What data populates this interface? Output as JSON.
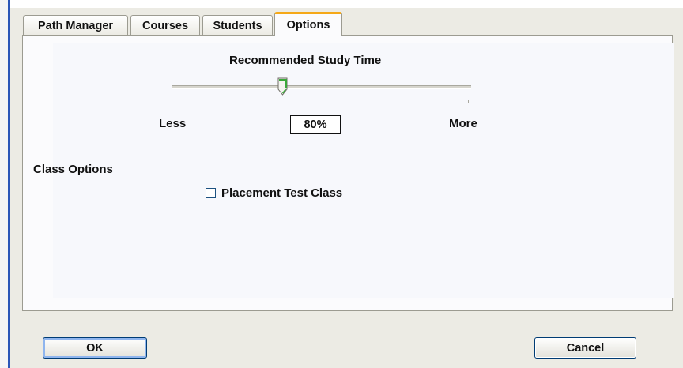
{
  "tabs": [
    {
      "label": "Path Manager"
    },
    {
      "label": "Courses"
    },
    {
      "label": "Students"
    },
    {
      "label": "Options",
      "active": true
    }
  ],
  "study_time": {
    "title": "Recommended Study Time",
    "min_label": "Less",
    "max_label": "More",
    "value_text": "80%",
    "slider_fraction": 0.36
  },
  "class_options": {
    "title": "Class Options",
    "placement_test_label": "Placement Test Class",
    "placement_test_checked": false
  },
  "buttons": {
    "ok_label": "OK",
    "cancel_label": "Cancel"
  },
  "colors": {
    "active_tab_accent": "#f5a818",
    "window_border": "#2b56b8",
    "button_border": "#003c74"
  }
}
